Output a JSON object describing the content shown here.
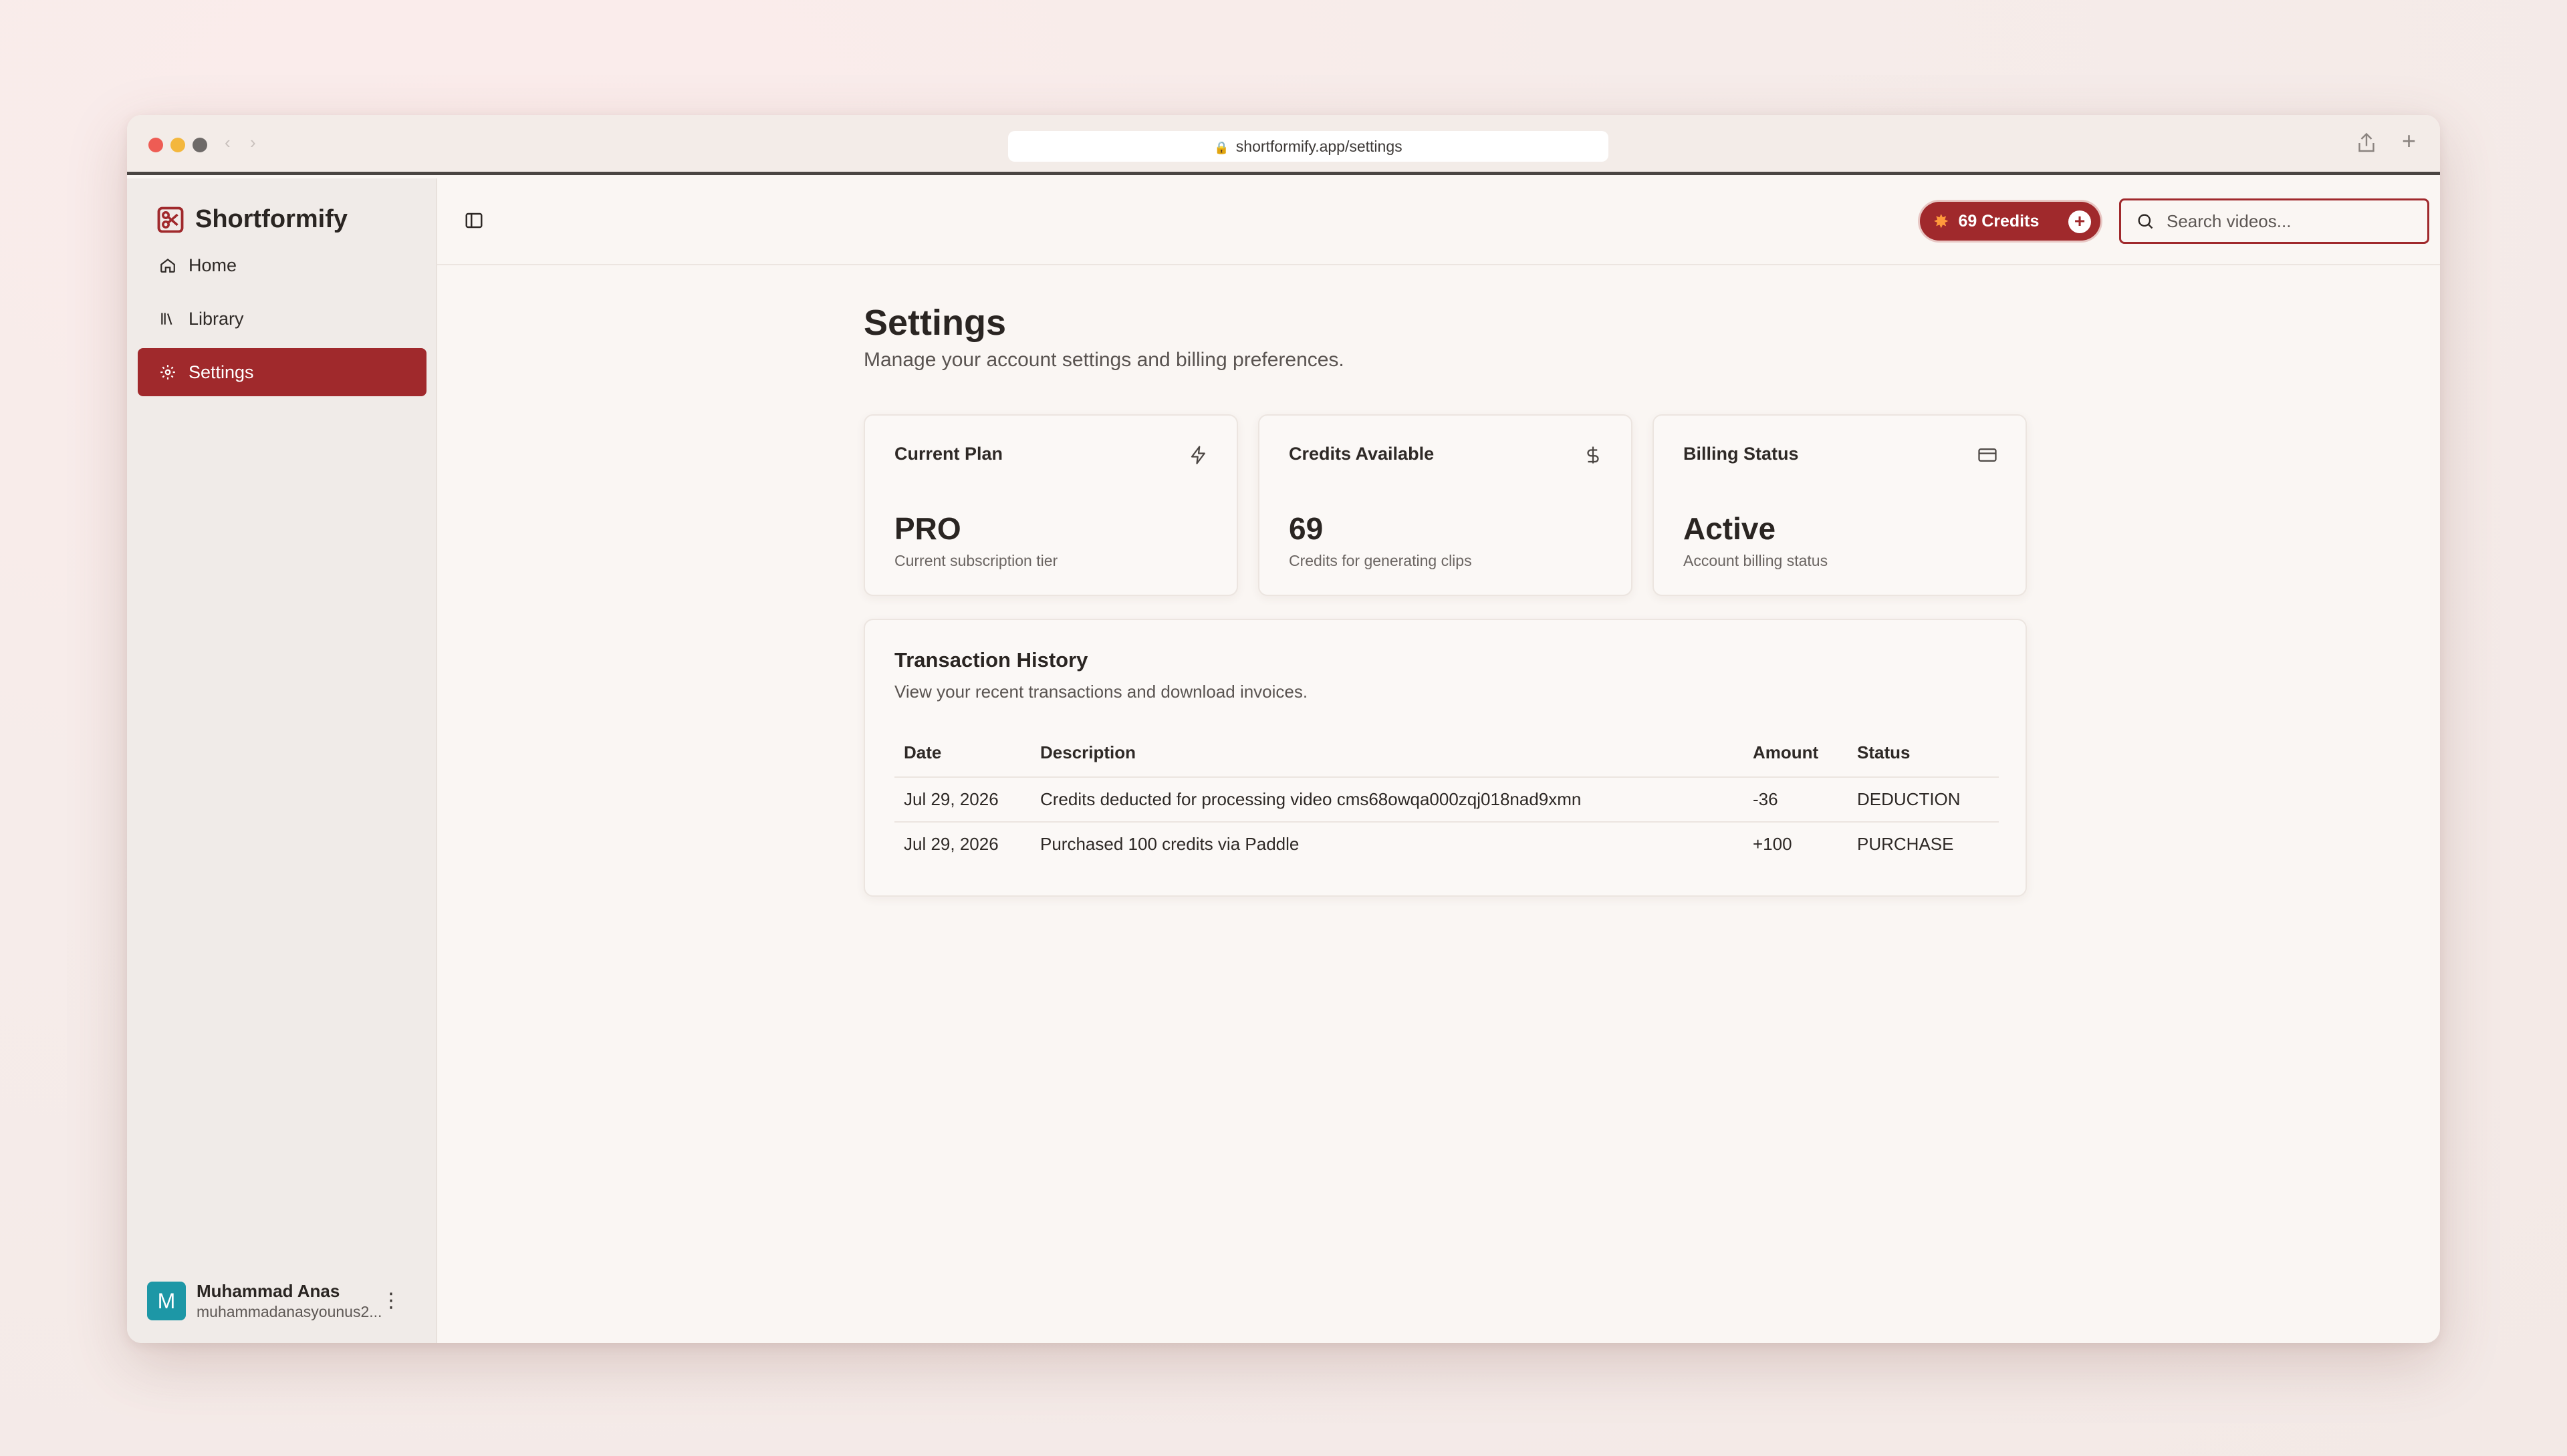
{
  "browser": {
    "url": "shortformify.app/settings"
  },
  "sidebar": {
    "brand": "Shortformify",
    "items": [
      {
        "label": "Home",
        "icon": "home-icon"
      },
      {
        "label": "Library",
        "icon": "library-icon"
      },
      {
        "label": "Settings",
        "icon": "gear-icon",
        "active": true
      }
    ],
    "user": {
      "initial": "M",
      "name": "Muhammad Anas",
      "email": "muhammadanasyounus2..."
    }
  },
  "topbar": {
    "credits_label": "69 Credits",
    "search_placeholder": "Search videos..."
  },
  "page": {
    "title": "Settings",
    "subtitle": "Manage your account settings and billing preferences."
  },
  "stats": [
    {
      "label": "Current Plan",
      "value": "PRO",
      "desc": "Current subscription tier",
      "icon": "zap-icon"
    },
    {
      "label": "Credits Available",
      "value": "69",
      "desc": "Credits for generating clips",
      "icon": "dollar-icon"
    },
    {
      "label": "Billing Status",
      "value": "Active",
      "desc": "Account billing status",
      "icon": "credit-card-icon"
    }
  ],
  "transactions": {
    "title": "Transaction History",
    "subtitle": "View your recent transactions and download invoices.",
    "columns": [
      "Date",
      "Description",
      "Amount",
      "Status"
    ],
    "rows": [
      {
        "date": "Jul 29, 2026",
        "description": "Credits deducted for processing video cms68owqa000zqj018nad9xmn",
        "amount": "-36",
        "status": "DEDUCTION"
      },
      {
        "date": "Jul 29, 2026",
        "description": "Purchased 100 credits via Paddle",
        "amount": "+100",
        "status": "PURCHASE"
      }
    ]
  },
  "colors": {
    "accent": "#a0292c",
    "avatar": "#1d97a6",
    "credits_spark": "#ff9a3c"
  }
}
